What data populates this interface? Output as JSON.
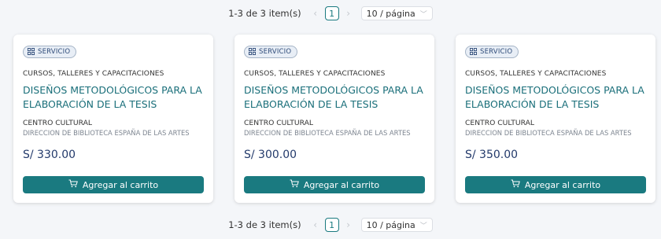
{
  "pagination": {
    "total_text": "1-3 de 3 item(s)",
    "current_page": "1",
    "page_size_label": "10 / página"
  },
  "products": [
    {
      "badge": "SERVICIO",
      "category": "CURSOS, TALLERES Y CAPACITACIONES",
      "title": "DISEÑOS METODOLÓGICOS PARA LA ELABORACIÓN DE LA TESIS (ESTUDIANTE...",
      "org": "CENTRO CULTURAL",
      "dept": "DIRECCION DE BIBLIOTECA ESPAÑA DE LAS ARTES",
      "price": "S/ 330.00",
      "button": "Agregar al carrito"
    },
    {
      "badge": "SERVICIO",
      "category": "CURSOS, TALLERES Y CAPACITACIONES",
      "title": "DISEÑOS METODOLÓGICOS PARA LA ELABORACIÓN DE LA TESIS (ESTUDIANTE...",
      "org": "CENTRO CULTURAL",
      "dept": "DIRECCION DE BIBLIOTECA ESPAÑA DE LAS ARTES",
      "price": "S/ 300.00",
      "button": "Agregar al carrito"
    },
    {
      "badge": "SERVICIO",
      "category": "CURSOS, TALLERES Y CAPACITACIONES",
      "title": "DISEÑOS METODOLÓGICOS PARA LA ELABORACIÓN DE LA TESIS (PÚBLICO EN...",
      "org": "CENTRO CULTURAL",
      "dept": "DIRECCION DE BIBLIOTECA ESPAÑA DE LAS ARTES",
      "price": "S/ 350.00",
      "button": "Agregar al carrito"
    }
  ],
  "icons": {
    "badge": "apps-grid-icon",
    "cart": "shopping-cart-icon",
    "prev": "chevron-left-icon",
    "next": "chevron-right-icon",
    "dropdown": "chevron-down-icon"
  },
  "colors": {
    "accent": "#1a7a80",
    "title": "#1a6f7a",
    "price": "#233a6b",
    "badge_bg": "#e8eef6"
  }
}
